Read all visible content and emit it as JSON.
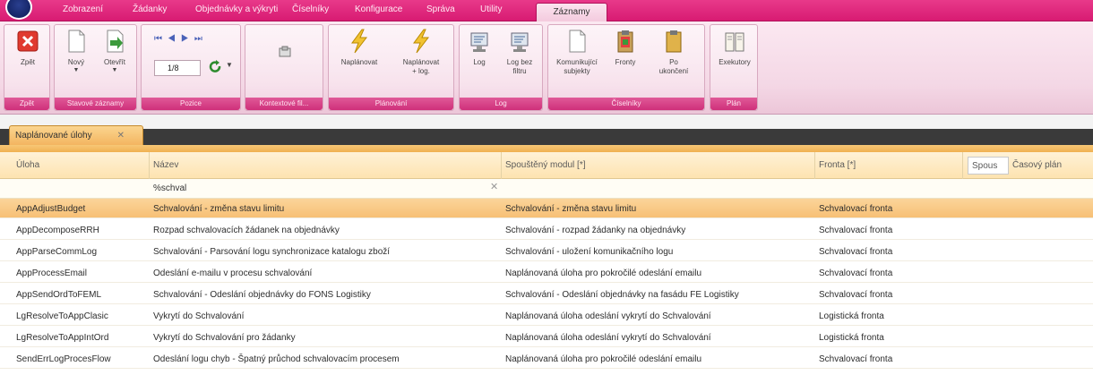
{
  "ribbon_tabs": [
    "Zobrazení",
    "Žádanky",
    "Objednávky a výkryti",
    "Číselníky",
    "Konfigurace",
    "Správa",
    "Utility",
    "Záznamy"
  ],
  "active_tab": "Záznamy",
  "ribbon": {
    "close_label": "Zpět",
    "new_label": "Nový",
    "open_label": "Otevřít",
    "page_value": "1/8",
    "run_label": "Naplánovat",
    "run_log_label": "Naplánovat\n+ log.",
    "log_label": "Log",
    "log_nofilter_label": "Log bez\nfiltru",
    "subjects_label": "Komunikující\nsubjekty",
    "queues_label": "Fronty",
    "after_end_label": "Po\nukončení",
    "executors_label": "Exekutory",
    "groups": {
      "g1": "Zpět",
      "g2": "Stavové záznamy",
      "g3": "Pozice",
      "g4": "Kontextové fil...",
      "g5": "Plánování",
      "g6": "Log",
      "g7": "Číselníky",
      "g8": "Plán"
    }
  },
  "document_tab": {
    "label": "Naplánované úlohy"
  },
  "columns": {
    "uloha": "Úloha",
    "nazev": "Název",
    "modul": "Spouštěný modul [*]",
    "fronta": "Fronta [*]",
    "spous": "Spous",
    "casovy": "Časový plán"
  },
  "filter": {
    "nazev": "%schval"
  },
  "rows": [
    {
      "uloha": "AppAdjustBudget",
      "nazev": "Schvalování - změna stavu limitu",
      "modul": "Schvalování - změna stavu limitu",
      "fronta": "Schvalovací fronta"
    },
    {
      "uloha": "AppDecomposeRRH",
      "nazev": "Rozpad schvalovacích žádanek na objednávky",
      "modul": "Schvalování - rozpad žádanky na objednávky",
      "fronta": "Schvalovací fronta"
    },
    {
      "uloha": "AppParseCommLog",
      "nazev": "Schvalování - Parsování logu synchronizace katalogu zboží",
      "modul": "Schvalování - uložení komunikačního logu",
      "fronta": "Schvalovací fronta"
    },
    {
      "uloha": "AppProcessEmail",
      "nazev": "Odeslání e-mailu v procesu schvalování",
      "modul": "Naplánovaná úloha pro pokročilé odeslání emailu",
      "fronta": "Schvalovací fronta"
    },
    {
      "uloha": "AppSendOrdToFEML",
      "nazev": "Schvalování - Odeslání objednávky do FONS Logistiky",
      "modul": "Schvalování - Odeslání objednávky na fasádu FE Logistiky",
      "fronta": "Schvalovací fronta"
    },
    {
      "uloha": "LgResolveToAppClasic",
      "nazev": "Vykrytí do Schvalování",
      "modul": "Naplánovaná úloha odeslání vykrytí do Schvalování",
      "fronta": "Logistická fronta"
    },
    {
      "uloha": "LgResolveToAppIntOrd",
      "nazev": "Vykrytí do Schvalování pro žádanky",
      "modul": "Naplánovaná úloha odeslání vykrytí do Schvalování",
      "fronta": "Logistická fronta"
    },
    {
      "uloha": "SendErrLogProcesFlow",
      "nazev": "Odeslání logu chyb - Špatný průchod schvalovacím procesem",
      "modul": "Naplánovaná úloha pro pokročilé odeslání emailu",
      "fronta": "Schvalovací fronta"
    }
  ],
  "selected_row": 0,
  "colors": {
    "accent": "#d81b72",
    "selection": "#f7c075",
    "header": "#fde3b0"
  }
}
